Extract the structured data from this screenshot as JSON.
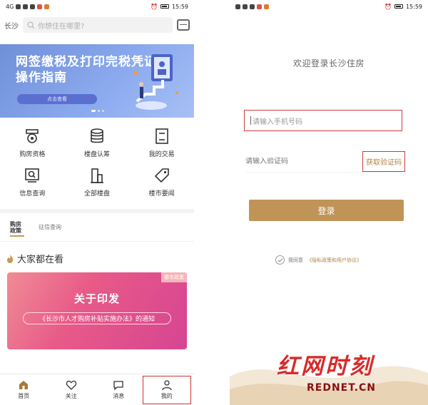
{
  "left": {
    "status": {
      "time": "15:59",
      "network": "4G"
    },
    "header": {
      "city": "长沙",
      "search_placeholder": "你想住在哪里?"
    },
    "banner": {
      "title": "网签缴税及打印完税凭证操作指南",
      "button": "点击查看"
    },
    "grid": [
      {
        "label": "购房资格",
        "icon": "qualification-icon"
      },
      {
        "label": "楼盘认筹",
        "icon": "coins-icon"
      },
      {
        "label": "我的交易",
        "icon": "document-icon"
      },
      {
        "label": "信息查询",
        "icon": "search-doc-icon"
      },
      {
        "label": "全部楼盘",
        "icon": "building-icon"
      },
      {
        "label": "楼市要闻",
        "icon": "tag-icon"
      }
    ],
    "tabs": {
      "active": "购房政策",
      "other": "征信查询"
    },
    "section_title": "大家都在看",
    "card": {
      "badge": "楼市政策",
      "title": "关于印发",
      "subtitle": "《长沙市人才购房补贴实施办法》的通知"
    },
    "nav": [
      {
        "label": "首页",
        "icon": "home-icon"
      },
      {
        "label": "关注",
        "icon": "heart-icon"
      },
      {
        "label": "消息",
        "icon": "chat-icon"
      },
      {
        "label": "我的",
        "icon": "user-icon"
      }
    ]
  },
  "right": {
    "status": {
      "time": "15:59"
    },
    "welcome": "欢迎登录长沙住房",
    "phone_placeholder": "请输入手机号码",
    "code_placeholder": "请输入验证码",
    "get_code": "获取验证码",
    "login": "登录",
    "agree_prefix": "我同意",
    "agree_link": "《隐私政策和用户协议》"
  },
  "watermark": {
    "logo": "红网时刻",
    "url": "REDNET.CN"
  },
  "colors": {
    "gold": "#c09457",
    "highlight_red": "#cf3b3b",
    "banner_blue": "#7a98e0",
    "card_pink": "#e85a88"
  }
}
